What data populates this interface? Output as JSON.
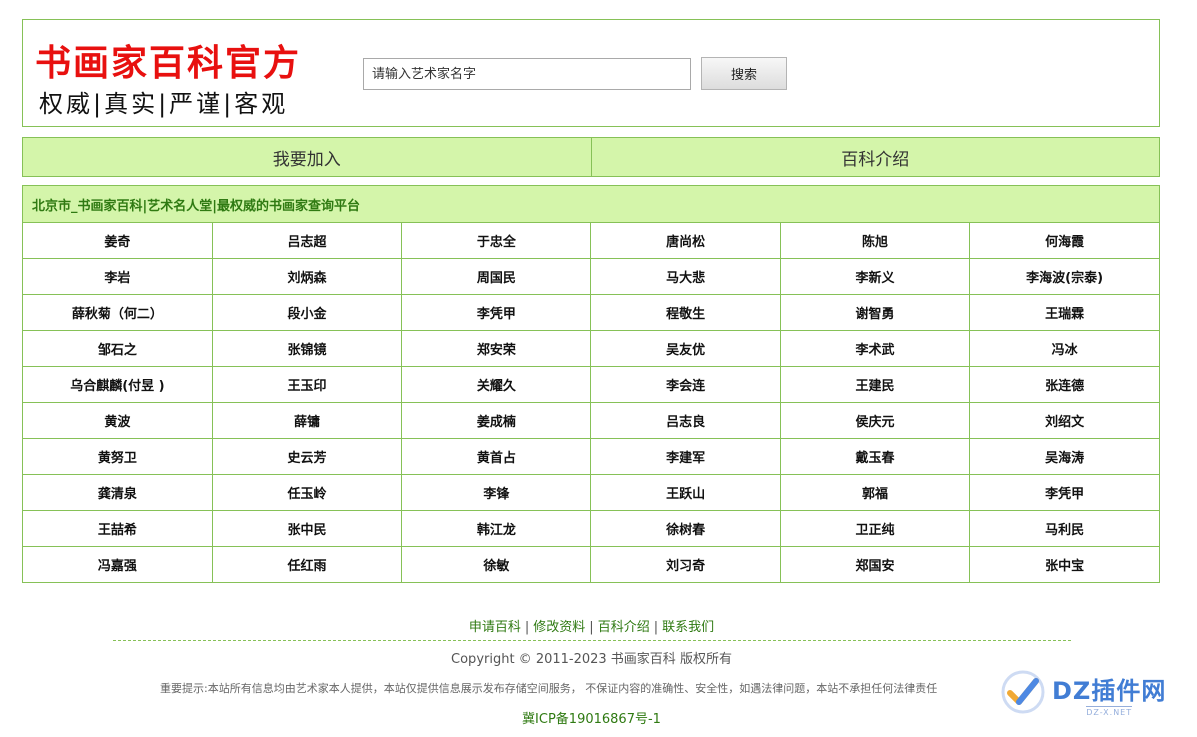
{
  "header": {
    "logo_title": "书画家百科官方",
    "logo_subtitle": "权威|真实|严谨|客观",
    "search_placeholder": "请输入艺术家名字",
    "search_button": "搜索"
  },
  "nav": {
    "items": [
      {
        "label": "我要加入"
      },
      {
        "label": "百科介绍"
      }
    ]
  },
  "list": {
    "heading": "北京市_书画家百科|艺术名人堂|最权威的书画家查询平台",
    "rows": [
      [
        "姜奇",
        "吕志超",
        "于忠全",
        "唐尚松",
        "陈旭",
        "何海霞"
      ],
      [
        "李岩",
        "刘炳森",
        "周国民",
        "马大悲",
        "李新义",
        "李海波(宗泰)"
      ],
      [
        "薛秋菊（何二）",
        "段小金",
        "李凭甲",
        "程敬生",
        "谢智勇",
        "王瑞霖"
      ],
      [
        "邹石之",
        "张锦镜",
        "郑安荣",
        "吴友优",
        "李术武",
        "冯冰"
      ],
      [
        "乌合麒麟(付昱 )",
        "王玉印",
        "关耀久",
        "李会连",
        "王建民",
        "张连德"
      ],
      [
        "黄波",
        "薛镛",
        "姜成楠",
        "吕志良",
        "侯庆元",
        "刘绍文"
      ],
      [
        "黄努卫",
        "史云芳",
        "黄首占",
        "李建军",
        "戴玉春",
        "吴海涛"
      ],
      [
        "龚清泉",
        "任玉岭",
        "李锋",
        "王跃山",
        "郭福",
        "李凭甲"
      ],
      [
        "王喆希",
        "张中民",
        "韩江龙",
        "徐树春",
        "卫正纯",
        "马利民"
      ],
      [
        "冯嘉强",
        "任红雨",
        "徐敏",
        "刘习奇",
        "郑国安",
        "张中宝"
      ]
    ]
  },
  "footer": {
    "links": [
      "申请百科",
      "修改资料",
      "百科介绍",
      "联系我们"
    ],
    "separator": "|",
    "copyright": "Copyright © 2011-2023 书画家百科 版权所有",
    "notice": "重要提示:本站所有信息均由艺术家本人提供，本站仅提供信息展示发布存储空间服务， 不保证内容的准确性、安全性，如遇法律问题，本站不承担任何法律责任",
    "icp": "冀ICP备19016867号-1"
  },
  "watermark": {
    "main": "DZ插件网",
    "sub": "DZ-X.NET",
    "icon": "dz-check-logo-icon"
  },
  "colors": {
    "brand_red": "#e8100f",
    "border_green": "#86c157",
    "header_green_bg": "#d4f5aa",
    "link_green": "#2f7a12"
  }
}
